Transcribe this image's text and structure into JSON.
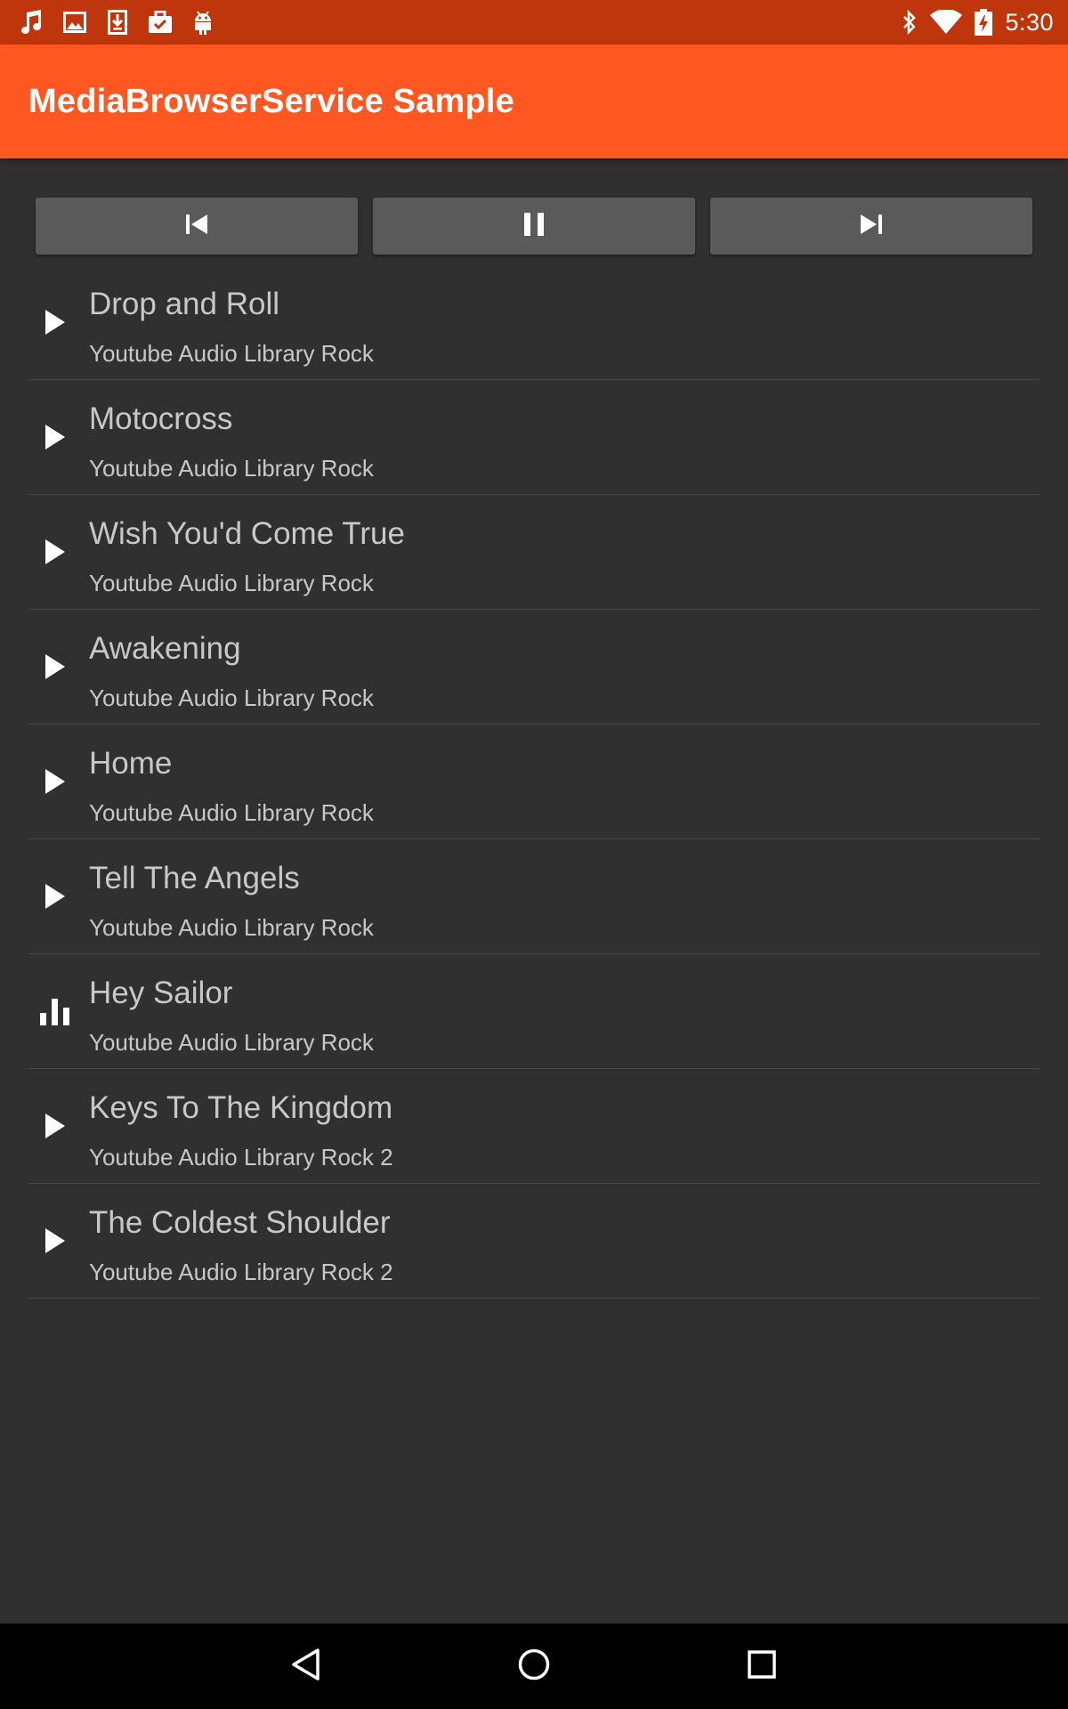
{
  "status_bar": {
    "time": "5:30",
    "left_icons": [
      "music-note-icon",
      "image-icon",
      "download-icon",
      "clipboard-check-icon",
      "android-icon"
    ],
    "right_icons": [
      "bluetooth-icon",
      "wifi-icon",
      "battery-charging-icon"
    ]
  },
  "app_bar": {
    "title": "MediaBrowserService Sample",
    "color": "#FF5722",
    "status_color": "#BF360C"
  },
  "controls": {
    "previous_icon": "skip-previous-icon",
    "pause_icon": "pause-icon",
    "next_icon": "skip-next-icon"
  },
  "tracks": [
    {
      "title": "Drop and Roll",
      "subtitle": "Youtube Audio Library Rock",
      "icon": "play-icon"
    },
    {
      "title": "Motocross",
      "subtitle": "Youtube Audio Library Rock",
      "icon": "play-icon"
    },
    {
      "title": "Wish You'd Come True",
      "subtitle": "Youtube Audio Library Rock",
      "icon": "play-icon"
    },
    {
      "title": "Awakening",
      "subtitle": "Youtube Audio Library Rock",
      "icon": "play-icon"
    },
    {
      "title": "Home",
      "subtitle": "Youtube Audio Library Rock",
      "icon": "play-icon"
    },
    {
      "title": "Tell The Angels",
      "subtitle": "Youtube Audio Library Rock",
      "icon": "play-icon"
    },
    {
      "title": "Hey Sailor",
      "subtitle": "Youtube Audio Library Rock",
      "icon": "equalizer-icon"
    },
    {
      "title": "Keys To The Kingdom",
      "subtitle": "Youtube Audio Library Rock 2",
      "icon": "play-icon"
    },
    {
      "title": "The Coldest Shoulder",
      "subtitle": "Youtube Audio Library Rock 2",
      "icon": "play-icon"
    }
  ],
  "nav_bar": {
    "back_icon": "back-icon",
    "home_icon": "home-icon",
    "recents_icon": "recents-icon"
  }
}
